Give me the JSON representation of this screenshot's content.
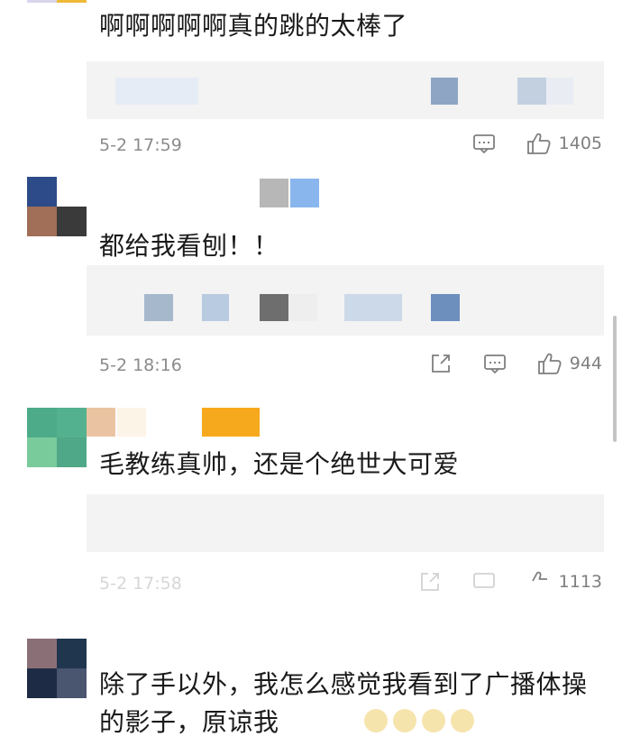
{
  "comments": [
    {
      "text": "啊啊啊啊啊真的跳的太棒了",
      "time": "5-2 17:59",
      "likes": "1405",
      "avatar_colors": [
        "#d9d4ec",
        "#efb93a",
        "#ffffff",
        "#ffffff"
      ],
      "reply_blocks": [
        "#e6ecf5",
        "#f0f2f6",
        "#8ea6c4",
        "#c2d0e0",
        "#e9edf3"
      ]
    },
    {
      "text": "都给我看刨！！",
      "time": "5-2 18:16",
      "likes": "944",
      "avatar_colors": [
        "#2c4b88",
        "#3b3b3b",
        "#a16e57",
        "#3a3a3a"
      ],
      "name_blocks": [
        "#b7b7b7",
        "#8ab6ee"
      ],
      "reply_blocks": [
        "#a5b8cc",
        "#b9cbe0",
        "#6e6e6e",
        "#ccd9e8",
        "#6c8fbd"
      ]
    },
    {
      "text": "毛教练真帅，还是个绝世大可爱",
      "time": "5-2 17:58",
      "likes": "1113",
      "avatar_colors": [
        "#4dab89",
        "#54b18f",
        "#7acb9b",
        "#4fa887"
      ],
      "name_blocks": [
        "#eac3a2",
        "#fdf4e8",
        "#f7a91d"
      ]
    },
    {
      "text": "除了手以外，我怎么感觉我看到了广播体操的影子，原谅我",
      "avatar_colors": [
        "#8b6f77",
        "#20364f",
        "#1d2b45",
        "#4a5570"
      ]
    }
  ],
  "icons": {
    "comment": "comment-icon",
    "like": "thumbs-up-icon",
    "share": "share-icon"
  },
  "colors": {
    "meta_text": "#8c8c8c",
    "reply_bg": "#f3f3f3",
    "comment_text": "#1a1a1a"
  }
}
